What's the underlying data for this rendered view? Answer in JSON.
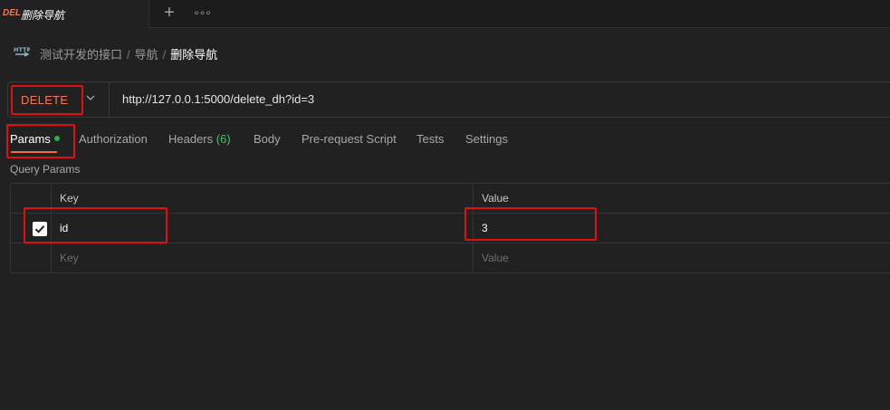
{
  "tab": {
    "method": "DEL",
    "title": "删除导航",
    "plus": "+",
    "more": "∘∘∘"
  },
  "breadcrumb": {
    "items": [
      "测试开发的接口",
      "导航"
    ],
    "current": "删除导航",
    "separator": "/"
  },
  "request": {
    "method": "DELETE",
    "url": "http://127.0.0.1:5000/delete_dh?id=3"
  },
  "tabs": {
    "params": "Params",
    "authorization": "Authorization",
    "headers": "Headers",
    "headers_count": "(6)",
    "body": "Body",
    "prerequest": "Pre-request Script",
    "tests": "Tests",
    "settings": "Settings"
  },
  "query_params": {
    "label": "Query Params",
    "key_header": "Key",
    "value_header": "Value",
    "rows": [
      {
        "key": "id",
        "value": "3",
        "checked": true
      }
    ],
    "key_placeholder": "Key",
    "value_placeholder": "Value"
  },
  "colors": {
    "method": "#f2795c",
    "accent": "#f26b3a",
    "dot": "#28b446",
    "annotation": "#e01010"
  }
}
